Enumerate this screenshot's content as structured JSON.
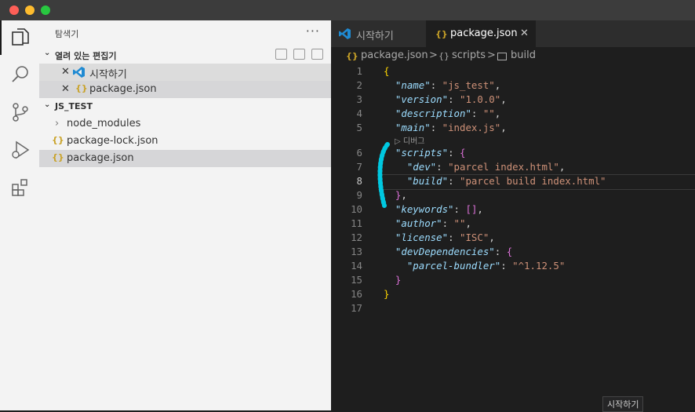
{
  "sidebar": {
    "title": "탐색기",
    "more": "···",
    "open_editors": {
      "title": "열려 있는 편집기",
      "items": [
        {
          "label": "시작하기"
        },
        {
          "label": "package.json"
        }
      ]
    },
    "project": {
      "title": "JS_TEST",
      "items": [
        {
          "label": "node_modules"
        },
        {
          "label": "package-lock.json"
        },
        {
          "label": "package.json"
        }
      ]
    }
  },
  "tabs": [
    {
      "label": "시작하기"
    },
    {
      "label": "package.json",
      "close": "✕"
    }
  ],
  "breadcrumb": {
    "file": "package.json",
    "sep": ">",
    "section": "scripts",
    "leaf": "build"
  },
  "code": {
    "line_numbers": [
      "1",
      "2",
      "3",
      "4",
      "5",
      "6",
      "7",
      "8",
      "9",
      "10",
      "11",
      "12",
      "13",
      "14",
      "15",
      "16",
      "17"
    ],
    "codelens": "디버그",
    "lines": [
      "{",
      "  \"name\": \"js_test\",",
      "  \"version\": \"1.0.0\",",
      "  \"description\": \"\",",
      "  \"main\": \"index.js\",",
      "  \"scripts\": {",
      "    \"dev\": \"parcel index.html\",",
      "    \"build\": \"parcel build index.html\"",
      "  },",
      "  \"keywords\": [],",
      "  \"author\": \"\",",
      "  \"license\": \"ISC\",",
      "  \"devDependencies\": {",
      "    \"parcel-bundler\": \"^1.12.5\"",
      "  }",
      "}",
      ""
    ]
  },
  "tooltip": "시작하기",
  "colors": {
    "accent": "#0078d4",
    "json_key": "#9cdcfe",
    "json_string": "#ce9178",
    "annotation": "#00c8e0"
  }
}
